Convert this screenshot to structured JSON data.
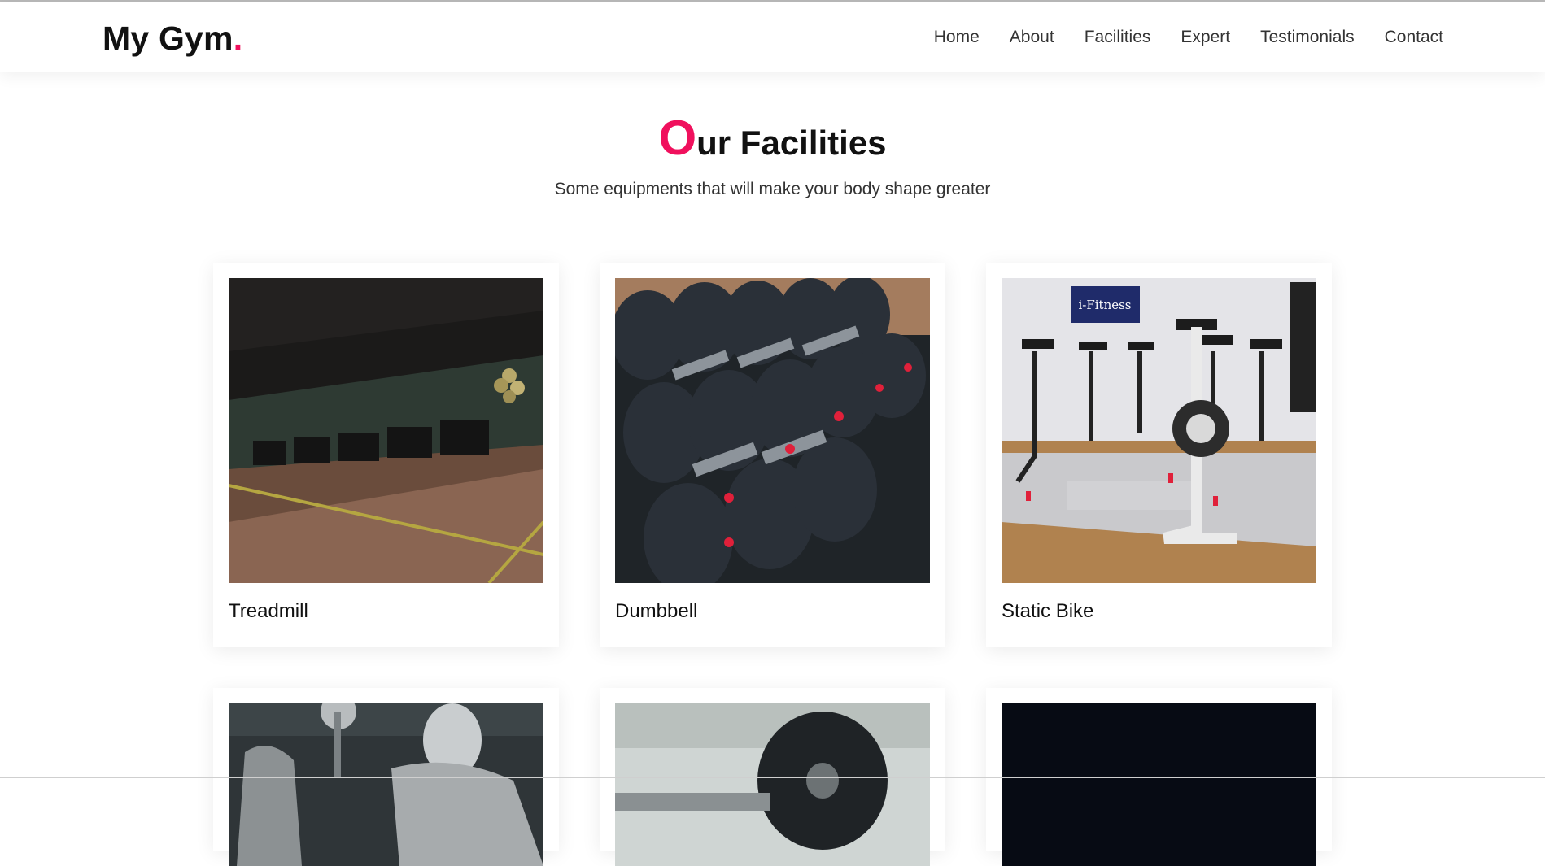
{
  "brand": {
    "name": "My Gym",
    "accent": "#f0105d",
    "dot": "."
  },
  "nav": {
    "items": [
      "Home",
      "About",
      "Facilities",
      "Expert",
      "Testimonials",
      "Contact"
    ]
  },
  "section": {
    "heading_first": "O",
    "heading_rest": "ur Facilities",
    "subtitle": "Some equipments that will make your body shape greater"
  },
  "facilities": [
    {
      "label": "Treadmill",
      "image": "treadmill-room-photo"
    },
    {
      "label": "Dumbbell",
      "image": "dumbbell-rack-photo"
    },
    {
      "label": "Static Bike",
      "image": "static-bike-room-photo",
      "sign": "i-Fitness"
    },
    {
      "label": "",
      "image": "weightlifter-photo"
    },
    {
      "label": "",
      "image": "weight-plate-photo"
    },
    {
      "label": "",
      "image": "dark-gym-photo"
    }
  ]
}
